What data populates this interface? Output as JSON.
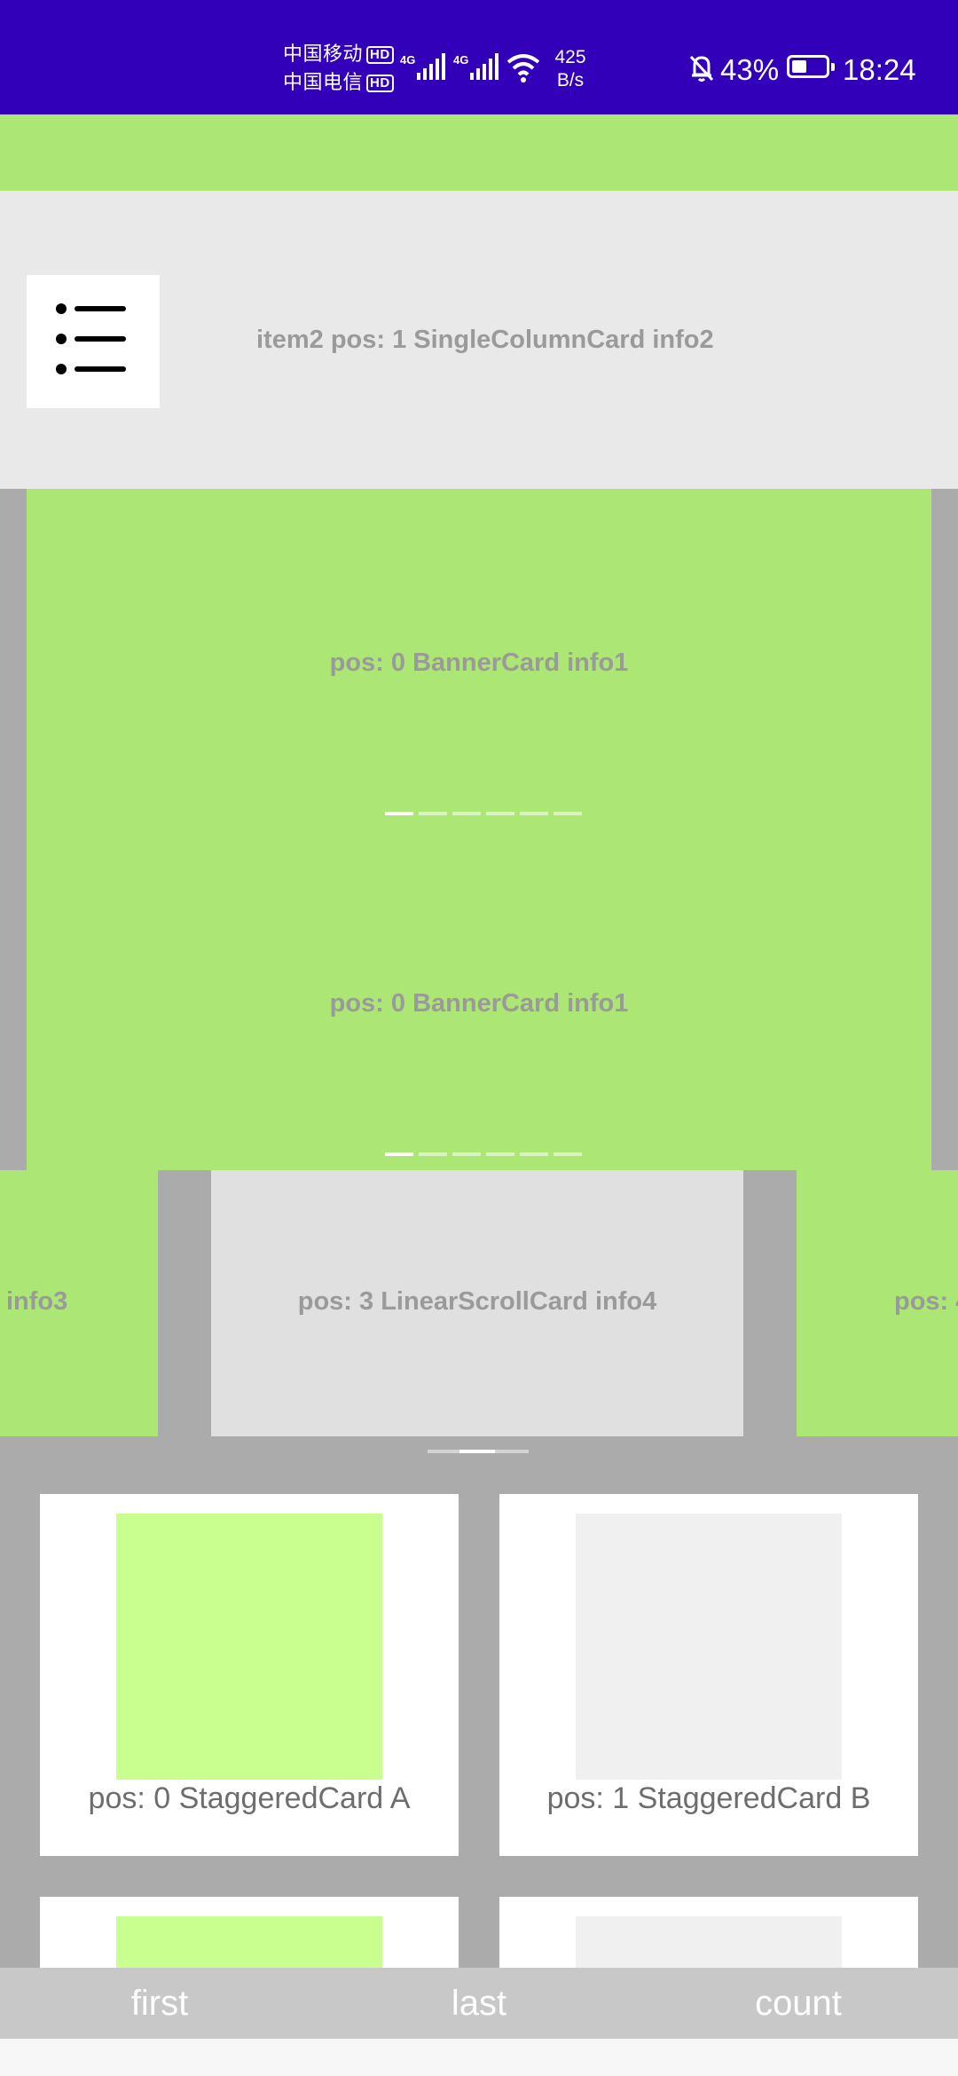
{
  "status_bar": {
    "carrier_1": "中国移动",
    "carrier_2": "中国电信",
    "hd_label": "HD",
    "network_1": "4G",
    "network_2": "4G",
    "speed_value": "425",
    "speed_unit": "B/s",
    "battery_percent": "43%",
    "battery_level": 0.43,
    "time": "18:24",
    "icons": [
      "signal-icon",
      "wifi-icon",
      "bell-off-icon",
      "battery-icon"
    ]
  },
  "single_column_card": {
    "text": "item2 pos: 1 SingleColumnCard info2",
    "icon": "list-icon"
  },
  "banner": {
    "slides": [
      {
        "text": "pos: 0 BannerCard info1",
        "indicator_count": 6,
        "active_index": 0
      },
      {
        "text": "pos: 0 BannerCard info1",
        "indicator_count": 6,
        "active_index": 0
      }
    ]
  },
  "linear_scroll": {
    "left_partial": "info3",
    "center": "pos: 3 LinearScrollCard info4",
    "right_partial": "pos: 4"
  },
  "staggered": {
    "cards": [
      {
        "label": "pos: 0 StaggeredCard A",
        "color": "#c8ff8e"
      },
      {
        "label": "pos: 1 StaggeredCard B",
        "color": "#f0f0f0"
      }
    ],
    "partial_colors": [
      "#c8ff8e",
      "#f0f0f0"
    ]
  },
  "bottom_bar": {
    "first": "first",
    "last": "last",
    "count": "count"
  },
  "colors": {
    "status_bar": "#3300b9",
    "green": "#ace674",
    "light_gray": "#e9e9e9",
    "gray_bg": "#ababab"
  }
}
